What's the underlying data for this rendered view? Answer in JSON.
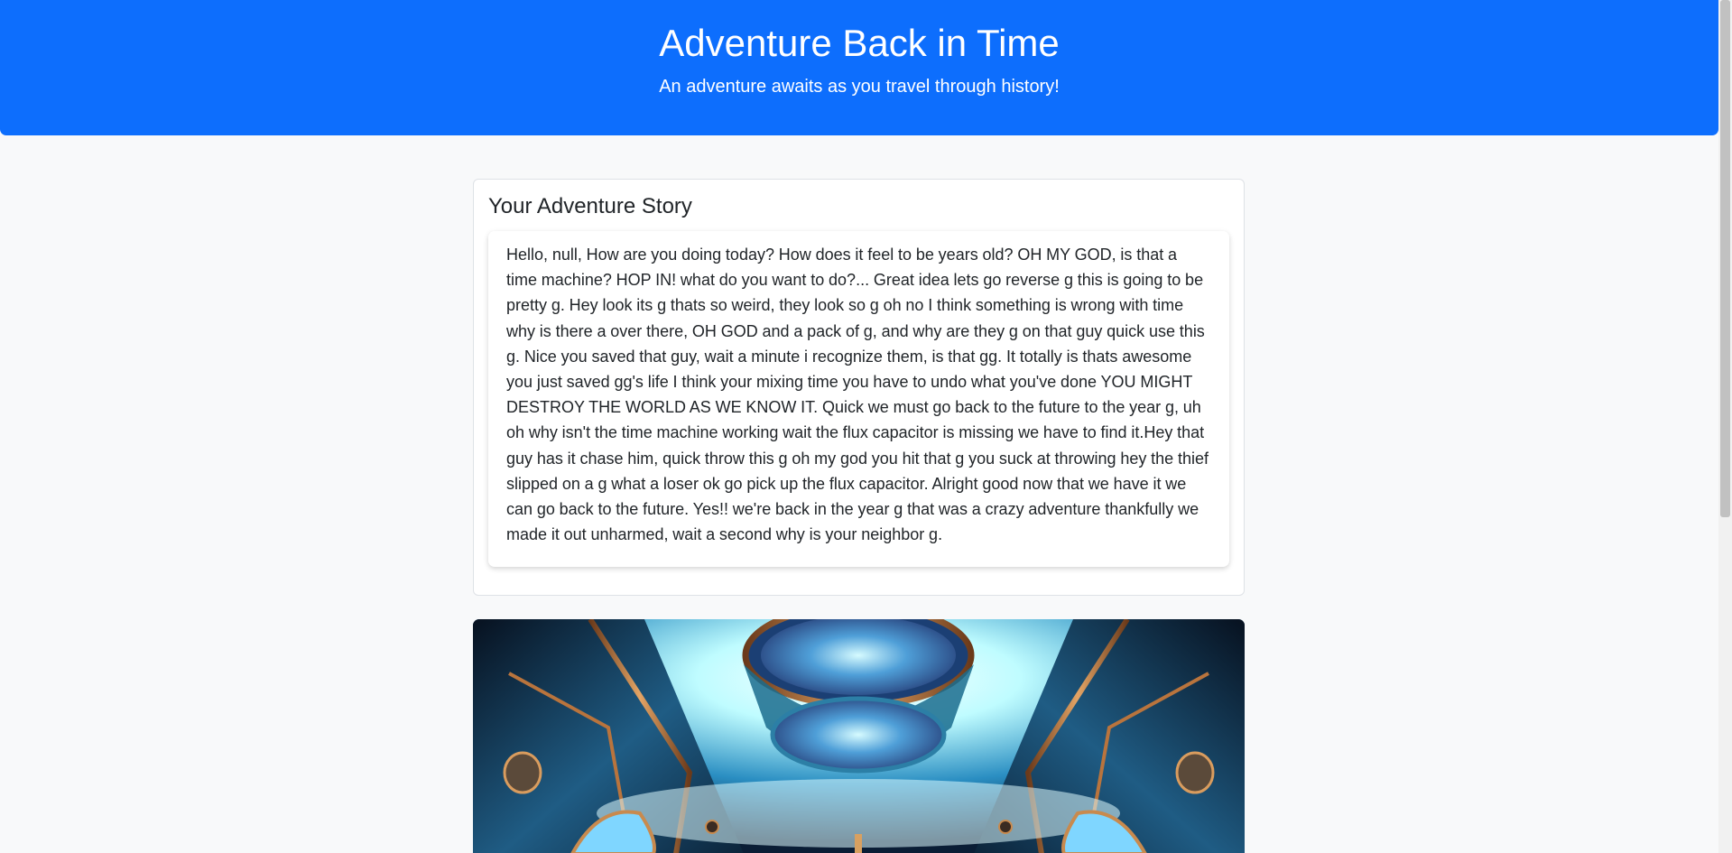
{
  "header": {
    "title": "Adventure Back in Time",
    "subtitle": "An adventure awaits as you travel through history!"
  },
  "story": {
    "heading": "Your Adventure Story",
    "text": "Hello, null, How are you doing today? How does it feel to be years old? OH MY GOD, is that a time machine? HOP IN! what do you want to do?... Great idea lets go reverse g this is going to be pretty g. Hey look its g thats so weird, they look so g oh no I think something is wrong with time why is there a over there, OH GOD and a pack of g, and why are they g on that guy quick use this g. Nice you saved that guy, wait a minute i recognize them, is that gg. It totally is thats awesome you just saved gg's life I think your mixing time you have to undo what you've done YOU MIGHT DESTROY THE WORLD AS WE KNOW IT. Quick we must go back to the future to the year g, uh oh why isn't the time machine working wait the flux capacitor is missing we have to find it.Hey that guy has it chase him, quick throw this g oh my god you hit that g you suck at throwing hey the thief slipped on a g what a loser ok go pick up the flux capacitor. Alright good now that we have it we can go back to the future. Yes!! we're back in the year g that was a crazy adventure thankfully we made it out unharmed, wait a second why is your neighbor g."
  },
  "image": {
    "subject": "time-machine-interior-illustration"
  },
  "colors": {
    "header_bg": "#0d6efd",
    "page_bg": "#f8f9fa",
    "text": "#212529"
  }
}
